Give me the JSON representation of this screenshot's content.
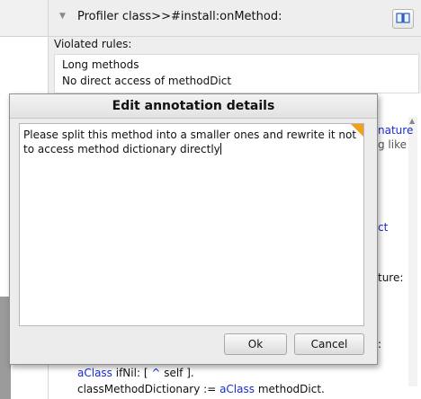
{
  "background_window": {
    "title": "Profiler class>>#install:onMethod:",
    "violated_label": "Violated rules:",
    "rules": [
      "Long methods",
      "No direct access of methodDict"
    ],
    "visible_fragments": [
      "nature",
      "g like",
      "ct",
      "ture:",
      ":"
    ],
    "code_lines": [
      {
        "parts": [
          "aClass",
          " ifNil: [ ",
          "^",
          " self ]."
        ]
      },
      {
        "parts": [
          "classMethodDictionary",
          " := ",
          "aClass",
          " methodDict."
        ]
      }
    ]
  },
  "dialog": {
    "title": "Edit annotation details",
    "text": "Please split this method into a smaller ones and rewrite it not to access method dictionary directly",
    "ok_label": "Ok",
    "cancel_label": "Cancel"
  },
  "icons": {
    "book": "book-icon",
    "expand": "triangle-down-icon",
    "scroll_up": "scroll-up-arrow-icon"
  },
  "colors": {
    "keyword_blue": "#1a2bd1",
    "corner_orange": "#f0a020"
  }
}
